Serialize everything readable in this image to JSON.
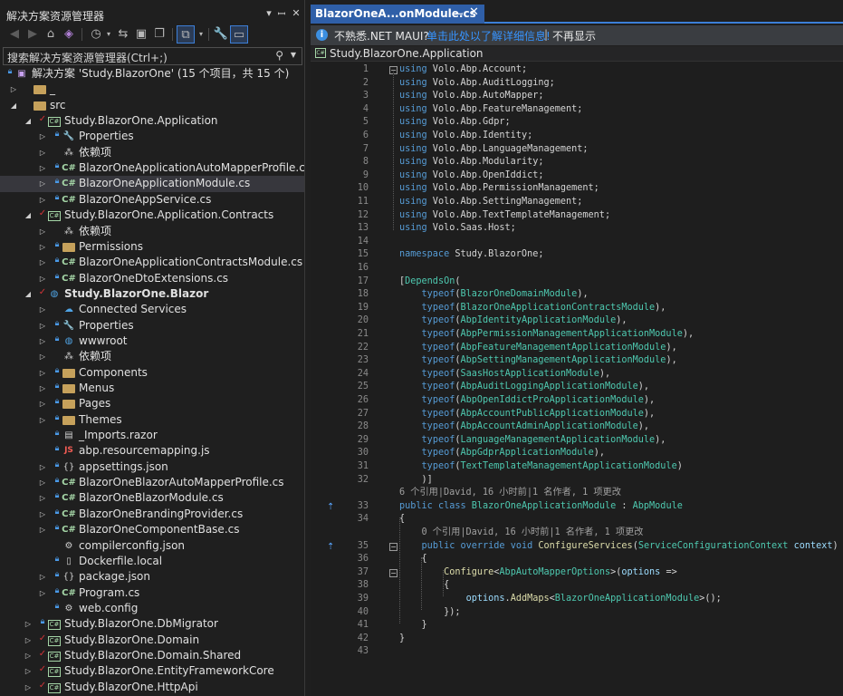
{
  "solution_explorer": {
    "title": "解决方案资源管理器",
    "search_placeholder": "搜索解决方案资源管理器(Ctrl+;)",
    "items": [
      {
        "label": "解决方案 'Study.BlazorOne' (15 个项目，共 15 个)",
        "icon": "solution-icon",
        "expand": "",
        "status": "lock",
        "indent": 0
      },
      {
        "label": "_",
        "icon": "folder-icon",
        "expand": "right",
        "status": "",
        "indent": 1
      },
      {
        "label": "src",
        "icon": "folder-icon",
        "expand": "down",
        "status": "",
        "indent": 1
      },
      {
        "label": "Study.BlazorOne.Application",
        "icon": "csproj-icon",
        "expand": "down",
        "status": "check",
        "indent": 2
      },
      {
        "label": "Properties",
        "icon": "properties-icon",
        "expand": "right",
        "status": "lock",
        "indent": 3
      },
      {
        "label": "依赖项",
        "icon": "dependencies-icon",
        "expand": "right",
        "status": "",
        "indent": 3
      },
      {
        "label": "BlazorOneApplicationAutoMapperProfile.cs",
        "icon": "csharp-file-icon",
        "expand": "right",
        "status": "lock",
        "indent": 3
      },
      {
        "label": "BlazorOneApplicationModule.cs",
        "icon": "csharp-file-icon",
        "expand": "right",
        "status": "lock",
        "indent": 3,
        "selected": true
      },
      {
        "label": "BlazorOneAppService.cs",
        "icon": "csharp-file-icon",
        "expand": "right",
        "status": "lock",
        "indent": 3
      },
      {
        "label": "Study.BlazorOne.Application.Contracts",
        "icon": "csproj-icon",
        "expand": "down",
        "status": "check",
        "indent": 2
      },
      {
        "label": "依赖项",
        "icon": "dependencies-icon",
        "expand": "right",
        "status": "",
        "indent": 3
      },
      {
        "label": "Permissions",
        "icon": "folder-icon",
        "expand": "right",
        "status": "lock",
        "indent": 3
      },
      {
        "label": "BlazorOneApplicationContractsModule.cs",
        "icon": "csharp-file-icon",
        "expand": "right",
        "status": "lock",
        "indent": 3
      },
      {
        "label": "BlazorOneDtoExtensions.cs",
        "icon": "csharp-file-icon",
        "expand": "right",
        "status": "lock",
        "indent": 3
      },
      {
        "label": "Study.BlazorOne.Blazor",
        "icon": "web-project-icon",
        "expand": "down",
        "status": "check",
        "indent": 2,
        "bold": true
      },
      {
        "label": "Connected Services",
        "icon": "connected-services-icon",
        "expand": "right",
        "status": "",
        "indent": 3
      },
      {
        "label": "Properties",
        "icon": "properties-icon",
        "expand": "right",
        "status": "lock",
        "indent": 3
      },
      {
        "label": "wwwroot",
        "icon": "globe-icon",
        "expand": "right",
        "status": "lock",
        "indent": 3
      },
      {
        "label": "依赖项",
        "icon": "dependencies-icon",
        "expand": "right",
        "status": "",
        "indent": 3
      },
      {
        "label": "Components",
        "icon": "folder-icon",
        "expand": "right",
        "status": "lock",
        "indent": 3
      },
      {
        "label": "Menus",
        "icon": "folder-icon",
        "expand": "right",
        "status": "lock",
        "indent": 3
      },
      {
        "label": "Pages",
        "icon": "folder-icon",
        "expand": "right",
        "status": "lock",
        "indent": 3
      },
      {
        "label": "Themes",
        "icon": "folder-icon",
        "expand": "right",
        "status": "lock",
        "indent": 3
      },
      {
        "label": "_Imports.razor",
        "icon": "razor-file-icon",
        "expand": "",
        "status": "lock",
        "indent": 3
      },
      {
        "label": "abp.resourcemapping.js",
        "icon": "js-file-icon",
        "expand": "",
        "status": "lock",
        "indent": 3
      },
      {
        "label": "appsettings.json",
        "icon": "json-file-icon",
        "expand": "right",
        "status": "lock",
        "indent": 3
      },
      {
        "label": "BlazorOneBlazorAutoMapperProfile.cs",
        "icon": "csharp-file-icon",
        "expand": "right",
        "status": "lock",
        "indent": 3
      },
      {
        "label": "BlazorOneBlazorModule.cs",
        "icon": "csharp-file-icon",
        "expand": "right",
        "status": "lock",
        "indent": 3
      },
      {
        "label": "BlazorOneBrandingProvider.cs",
        "icon": "csharp-file-icon",
        "expand": "right",
        "status": "lock",
        "indent": 3
      },
      {
        "label": "BlazorOneComponentBase.cs",
        "icon": "csharp-file-icon",
        "expand": "right",
        "status": "lock",
        "indent": 3
      },
      {
        "label": "compilerconfig.json",
        "icon": "config-file-icon",
        "expand": "",
        "status": "",
        "indent": 3
      },
      {
        "label": "Dockerfile.local",
        "icon": "file-icon",
        "expand": "",
        "status": "lock",
        "indent": 3
      },
      {
        "label": "package.json",
        "icon": "json-file-icon",
        "expand": "right",
        "status": "lock",
        "indent": 3
      },
      {
        "label": "Program.cs",
        "icon": "csharp-file-icon",
        "expand": "right",
        "status": "lock",
        "indent": 3
      },
      {
        "label": "web.config",
        "icon": "config-file-icon",
        "expand": "",
        "status": "lock",
        "indent": 3
      },
      {
        "label": "Study.BlazorOne.DbMigrator",
        "icon": "csproj-icon",
        "expand": "right",
        "status": "lock",
        "indent": 2
      },
      {
        "label": "Study.BlazorOne.Domain",
        "icon": "csproj-icon",
        "expand": "right",
        "status": "check",
        "indent": 2
      },
      {
        "label": "Study.BlazorOne.Domain.Shared",
        "icon": "csproj-icon",
        "expand": "right",
        "status": "check",
        "indent": 2
      },
      {
        "label": "Study.BlazorOne.EntityFrameworkCore",
        "icon": "csproj-icon",
        "expand": "right",
        "status": "check",
        "indent": 2
      },
      {
        "label": "Study.BlazorOne.HttpApi",
        "icon": "csproj-icon",
        "expand": "right",
        "status": "check",
        "indent": 2
      }
    ]
  },
  "editor": {
    "tab_label": "BlazorOneA...onModule.cs",
    "info_bar": {
      "message": "不熟悉.NET MAUI?",
      "link": "单击此处以了解详细信息!",
      "separator": "|",
      "dismiss": "不再显示"
    },
    "nav_project": "Study.BlazorOne.Application",
    "lines": [
      {
        "n": "1",
        "tokens": [
          [
            "kw",
            "using"
          ],
          [
            "tx",
            " Volo.Abp.Account;"
          ]
        ],
        "fold": "minus"
      },
      {
        "n": "2",
        "tokens": [
          [
            "kw",
            "using"
          ],
          [
            "tx",
            " Volo.Abp.AuditLogging;"
          ]
        ]
      },
      {
        "n": "3",
        "tokens": [
          [
            "kw",
            "using"
          ],
          [
            "tx",
            " Volo.Abp.AutoMapper;"
          ]
        ]
      },
      {
        "n": "4",
        "tokens": [
          [
            "kw",
            "using"
          ],
          [
            "tx",
            " Volo.Abp.FeatureManagement;"
          ]
        ]
      },
      {
        "n": "5",
        "tokens": [
          [
            "kw",
            "using"
          ],
          [
            "tx",
            " Volo.Abp.Gdpr;"
          ]
        ]
      },
      {
        "n": "6",
        "tokens": [
          [
            "kw",
            "using"
          ],
          [
            "tx",
            " Volo.Abp.Identity;"
          ]
        ]
      },
      {
        "n": "7",
        "tokens": [
          [
            "kw",
            "using"
          ],
          [
            "tx",
            " Volo.Abp.LanguageManagement;"
          ]
        ]
      },
      {
        "n": "8",
        "tokens": [
          [
            "kw",
            "using"
          ],
          [
            "tx",
            " Volo.Abp.Modularity;"
          ]
        ]
      },
      {
        "n": "9",
        "tokens": [
          [
            "kw",
            "using"
          ],
          [
            "tx",
            " Volo.Abp.OpenIddict;"
          ]
        ]
      },
      {
        "n": "10",
        "tokens": [
          [
            "kw",
            "using"
          ],
          [
            "tx",
            " Volo.Abp.PermissionManagement;"
          ]
        ]
      },
      {
        "n": "11",
        "tokens": [
          [
            "kw",
            "using"
          ],
          [
            "tx",
            " Volo.Abp.SettingManagement;"
          ]
        ]
      },
      {
        "n": "12",
        "tokens": [
          [
            "kw",
            "using"
          ],
          [
            "tx",
            " Volo.Abp.TextTemplateManagement;"
          ]
        ]
      },
      {
        "n": "13",
        "tokens": [
          [
            "kw",
            "using"
          ],
          [
            "tx",
            " Volo.Saas.Host;"
          ]
        ]
      },
      {
        "n": "14",
        "tokens": []
      },
      {
        "n": "15",
        "tokens": [
          [
            "kw",
            "namespace"
          ],
          [
            "tx",
            " Study.BlazorOne;"
          ]
        ]
      },
      {
        "n": "16",
        "tokens": []
      },
      {
        "n": "17",
        "tokens": [
          [
            "tx",
            "["
          ],
          [
            "ty",
            "DependsOn"
          ],
          [
            "tx",
            "("
          ]
        ]
      },
      {
        "n": "18",
        "tokens": [
          [
            "tx",
            "    "
          ],
          [
            "kw",
            "typeof"
          ],
          [
            "tx",
            "("
          ],
          [
            "ty",
            "BlazorOneDomainModule"
          ],
          [
            "tx",
            "),"
          ]
        ]
      },
      {
        "n": "19",
        "tokens": [
          [
            "tx",
            "    "
          ],
          [
            "kw",
            "typeof"
          ],
          [
            "tx",
            "("
          ],
          [
            "ty",
            "BlazorOneApplicationContractsModule"
          ],
          [
            "tx",
            "),"
          ]
        ]
      },
      {
        "n": "20",
        "tokens": [
          [
            "tx",
            "    "
          ],
          [
            "kw",
            "typeof"
          ],
          [
            "tx",
            "("
          ],
          [
            "ty",
            "AbpIdentityApplicationModule"
          ],
          [
            "tx",
            "),"
          ]
        ]
      },
      {
        "n": "21",
        "tokens": [
          [
            "tx",
            "    "
          ],
          [
            "kw",
            "typeof"
          ],
          [
            "tx",
            "("
          ],
          [
            "ty",
            "AbpPermissionManagementApplicationModule"
          ],
          [
            "tx",
            "),"
          ]
        ]
      },
      {
        "n": "22",
        "tokens": [
          [
            "tx",
            "    "
          ],
          [
            "kw",
            "typeof"
          ],
          [
            "tx",
            "("
          ],
          [
            "ty",
            "AbpFeatureManagementApplicationModule"
          ],
          [
            "tx",
            "),"
          ]
        ]
      },
      {
        "n": "23",
        "tokens": [
          [
            "tx",
            "    "
          ],
          [
            "kw",
            "typeof"
          ],
          [
            "tx",
            "("
          ],
          [
            "ty",
            "AbpSettingManagementApplicationModule"
          ],
          [
            "tx",
            "),"
          ]
        ]
      },
      {
        "n": "24",
        "tokens": [
          [
            "tx",
            "    "
          ],
          [
            "kw",
            "typeof"
          ],
          [
            "tx",
            "("
          ],
          [
            "ty",
            "SaasHostApplicationModule"
          ],
          [
            "tx",
            "),"
          ]
        ]
      },
      {
        "n": "25",
        "tokens": [
          [
            "tx",
            "    "
          ],
          [
            "kw",
            "typeof"
          ],
          [
            "tx",
            "("
          ],
          [
            "ty",
            "AbpAuditLoggingApplicationModule"
          ],
          [
            "tx",
            "),"
          ]
        ]
      },
      {
        "n": "26",
        "tokens": [
          [
            "tx",
            "    "
          ],
          [
            "kw",
            "typeof"
          ],
          [
            "tx",
            "("
          ],
          [
            "ty",
            "AbpOpenIddictProApplicationModule"
          ],
          [
            "tx",
            "),"
          ]
        ]
      },
      {
        "n": "27",
        "tokens": [
          [
            "tx",
            "    "
          ],
          [
            "kw",
            "typeof"
          ],
          [
            "tx",
            "("
          ],
          [
            "ty",
            "AbpAccountPublicApplicationModule"
          ],
          [
            "tx",
            "),"
          ]
        ]
      },
      {
        "n": "28",
        "tokens": [
          [
            "tx",
            "    "
          ],
          [
            "kw",
            "typeof"
          ],
          [
            "tx",
            "("
          ],
          [
            "ty",
            "AbpAccountAdminApplicationModule"
          ],
          [
            "tx",
            "),"
          ]
        ]
      },
      {
        "n": "29",
        "tokens": [
          [
            "tx",
            "    "
          ],
          [
            "kw",
            "typeof"
          ],
          [
            "tx",
            "("
          ],
          [
            "ty",
            "LanguageManagementApplicationModule"
          ],
          [
            "tx",
            "),"
          ]
        ]
      },
      {
        "n": "30",
        "tokens": [
          [
            "tx",
            "    "
          ],
          [
            "kw",
            "typeof"
          ],
          [
            "tx",
            "("
          ],
          [
            "ty",
            "AbpGdprApplicationModule"
          ],
          [
            "tx",
            "),"
          ]
        ]
      },
      {
        "n": "31",
        "tokens": [
          [
            "tx",
            "    "
          ],
          [
            "kw",
            "typeof"
          ],
          [
            "tx",
            "("
          ],
          [
            "ty",
            "TextTemplateManagementApplicationModule"
          ],
          [
            "tx",
            ")"
          ]
        ]
      },
      {
        "n": "32",
        "tokens": [
          [
            "tx",
            "    )]"
          ]
        ]
      },
      {
        "lens": "6 个引用|David, 16 小时前|1 名作者, 1 项更改"
      },
      {
        "n": "33",
        "tokens": [
          [
            "kw",
            "public"
          ],
          [
            "tx",
            " "
          ],
          [
            "kw",
            "class"
          ],
          [
            "tx",
            " "
          ],
          [
            "ty",
            "BlazorOneApplicationModule"
          ],
          [
            "tx",
            " : "
          ],
          [
            "ty",
            "AbpModule"
          ]
        ],
        "codelens_icon": true
      },
      {
        "n": "34",
        "tokens": [
          [
            "tx",
            "{"
          ]
        ]
      },
      {
        "lens": "    0 个引用|David, 16 小时前|1 名作者, 1 项更改"
      },
      {
        "n": "35",
        "tokens": [
          [
            "tx",
            "    "
          ],
          [
            "kw",
            "public"
          ],
          [
            "tx",
            " "
          ],
          [
            "kw",
            "override"
          ],
          [
            "tx",
            " "
          ],
          [
            "kw",
            "void"
          ],
          [
            "tx",
            " "
          ],
          [
            "fn",
            "ConfigureServices"
          ],
          [
            "tx",
            "("
          ],
          [
            "ty",
            "ServiceConfigurationContext"
          ],
          [
            "tx",
            " "
          ],
          [
            "pm",
            "context"
          ],
          [
            "tx",
            ")"
          ]
        ],
        "fold": "minus",
        "codelens_icon": true
      },
      {
        "n": "36",
        "tokens": [
          [
            "tx",
            "    {"
          ]
        ]
      },
      {
        "n": "37",
        "tokens": [
          [
            "tx",
            "        "
          ],
          [
            "fn",
            "Configure"
          ],
          [
            "tx",
            "<"
          ],
          [
            "ty",
            "AbpAutoMapperOptions"
          ],
          [
            "tx",
            ">("
          ],
          [
            "pm",
            "options"
          ],
          [
            "tx",
            " =>"
          ]
        ],
        "fold": "minus"
      },
      {
        "n": "38",
        "tokens": [
          [
            "tx",
            "        {"
          ]
        ]
      },
      {
        "n": "39",
        "tokens": [
          [
            "tx",
            "            "
          ],
          [
            "pm",
            "options"
          ],
          [
            "tx",
            "."
          ],
          [
            "fn",
            "AddMaps"
          ],
          [
            "tx",
            "<"
          ],
          [
            "ty",
            "BlazorOneApplicationModule"
          ],
          [
            "tx",
            ">();"
          ]
        ]
      },
      {
        "n": "40",
        "tokens": [
          [
            "tx",
            "        });"
          ]
        ]
      },
      {
        "n": "41",
        "tokens": [
          [
            "tx",
            "    }"
          ]
        ]
      },
      {
        "n": "42",
        "tokens": [
          [
            "tx",
            "}"
          ]
        ]
      },
      {
        "n": "43",
        "tokens": []
      }
    ]
  }
}
